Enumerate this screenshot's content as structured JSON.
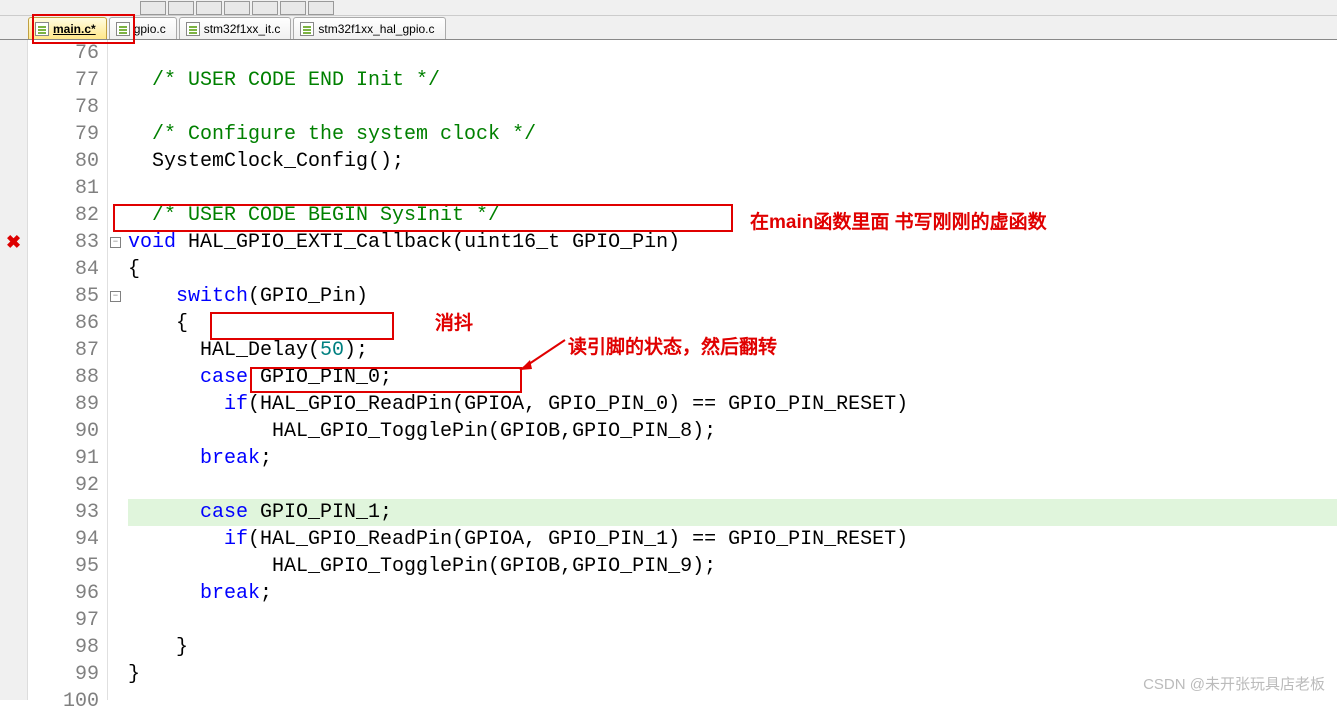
{
  "tabs": [
    {
      "label": "main.c*"
    },
    {
      "label": "gpio.c"
    },
    {
      "label": "stm32f1xx_it.c"
    },
    {
      "label": "stm32f1xx_hal_gpio.c"
    }
  ],
  "lines": {
    "start": 76,
    "end": 100
  },
  "code": {
    "l76": "  /* USER CODE END Init */",
    "l77": "",
    "l78": "  /* Configure the system clock */",
    "l79_a": "  SystemClock_Config();",
    "l80": "",
    "l81": "  /* USER CODE BEGIN SysInit */",
    "l82_kw": "void",
    "l82_rest": " HAL_GPIO_EXTI_Callback(uint16_t GPIO_Pin)",
    "l83": "{",
    "l84_kw": "switch",
    "l84_rest": "(GPIO_Pin)",
    "l85": "    {",
    "l86_a": "      HAL_Delay(",
    "l86_num": "50",
    "l86_b": ");",
    "l87_kw": "case",
    "l87_rest": " GPIO_PIN_0;",
    "l88_kw": "if",
    "l88_rest": "(HAL_GPIO_ReadPin(GPIOA, GPIO_PIN_0) == GPIO_PIN_RESET)",
    "l89": "            HAL_GPIO_TogglePin(GPIOB,GPIO_PIN_8);",
    "l90_kw": "break",
    "l90_rest": ";",
    "l91": "",
    "l92_kw": "case",
    "l92_rest": " GPIO_PIN_1;",
    "l93_kw": "if",
    "l93_rest": "(HAL_GPIO_ReadPin(GPIOA, GPIO_PIN_1) == GPIO_PIN_RESET)",
    "l94": "            HAL_GPIO_TogglePin(GPIOB,GPIO_PIN_9);",
    "l95_kw": "break",
    "l95_rest": ";",
    "l96": "",
    "l97": "    }",
    "l98": "}"
  },
  "annotations": {
    "main_comment": "在main函数里面 书写刚刚的虚函数",
    "debounce": "消抖",
    "read_pin": "读引脚的状态，然后翻转"
  },
  "watermark": "CSDN @未开张玩具店老板"
}
